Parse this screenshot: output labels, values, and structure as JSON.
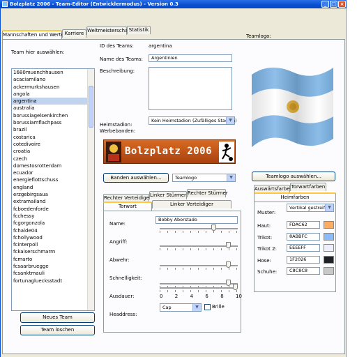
{
  "window": {
    "title": "Bolzplatz 2006 - Team-Editor (Entwicklermodus) - Version 0.3",
    "btn_min": "_",
    "btn_max": "□",
    "btn_close": "×"
  },
  "tabs": [
    {
      "label": "Mannschaften und Werte"
    },
    {
      "label": "Karriere"
    },
    {
      "label": "Weltmeisterschaft"
    },
    {
      "label": "Statistik"
    }
  ],
  "left": {
    "heading": "Team hier auswählen:",
    "teams": [
      "1680muenchhausen",
      "acaciamilano",
      "ackermurkshausen",
      "angola",
      "argentina",
      "australia",
      "borussiagelsenkirchen",
      "borussiamflachpass",
      "brazil",
      "costarica",
      "cotedivoire",
      "croatia",
      "czech",
      "domestosrotterdam",
      "ecuador",
      "energiefiottschuss",
      "england",
      "erzgebirgsaua",
      "extramailand",
      "fcboedenforde",
      "fcchessy",
      "fcgorgonzola",
      "fchalde04",
      "fchollywood",
      "fcinterpoll",
      "fckaiserschmarrn",
      "fcmarto",
      "fcsaarbruegge",
      "fcsanktmauli",
      "fortunagluecksstadt"
    ],
    "selected_index": 4,
    "new_team_button": "Neues Team",
    "delete_team_button": "Team loschen"
  },
  "details": {
    "id_label": "ID des Teams:",
    "id_value": "argentina",
    "name_label": "Name des Teams:",
    "name_value": "Argentinien",
    "desc_label": "Beschreibung:",
    "desc_value": "",
    "stadium_label": "Heimstadion:",
    "stadium_value": "Kein Heimstadion (Zufälliges Stadion)",
    "sponsor_label": "Werbebanden:",
    "banner_text": "Bolzplatz 2006",
    "banner_choose_button": "Banden auswählen...",
    "banner_combo_value": "Teamlogo",
    "teamlogo_label": "Teamlogo:",
    "teamlogo_button": "Teamlogo auswählen..."
  },
  "player_tabs": {
    "row_top": [
      {
        "label": "Rechter Verteidiger"
      },
      {
        "label": "Linker Stürmer"
      },
      {
        "label": "Rechter Stürmer"
      }
    ],
    "row_bottom": [
      {
        "label": "Torwart"
      },
      {
        "label": "Linker Verteidiger"
      }
    ]
  },
  "player": {
    "name_label": "Name:",
    "name_value": "Bobby Aborstado",
    "angriff_label": "Angriff:",
    "abwehr_label": "Abwehr:",
    "schnelligkeit_label": "Schnelligkeit:",
    "ausdauer_label": "Ausdauer:",
    "headdress_label": "Headdress:",
    "headdress_value": "Cap",
    "brille_label": "Brille",
    "scale_min": "0",
    "scale_ticks": [
      "0",
      "2",
      "4",
      "6",
      "8",
      "10"
    ],
    "values": {
      "name_slider": 7,
      "angriff": 9,
      "abwehr": 9,
      "schnelligkeit": 9,
      "ausdauer": 10
    }
  },
  "colors_tabs": {
    "row_top": [
      {
        "label": "Auswärtsfarben"
      },
      {
        "label": "Torwartfarben"
      }
    ],
    "row_bottom": [
      {
        "label": "Heimfarben"
      }
    ]
  },
  "colors": {
    "muster_label": "Muster:",
    "muster_value": "Vertikal gestreift",
    "rows": [
      {
        "label": "Haut:",
        "hex": "FDAC62",
        "color": "#FDAC62"
      },
      {
        "label": "Trikot:",
        "hex": "8ABBFC",
        "color": "#8ABBFC"
      },
      {
        "label": "Trikot 2:",
        "hex": "EEEEFF",
        "color": "#EEEEFF"
      },
      {
        "label": "Hose:",
        "hex": "1F2026",
        "color": "#1F2026"
      },
      {
        "label": "Schuhe:",
        "hex": "C8C8C8",
        "color": "#C8C8C8"
      }
    ]
  }
}
